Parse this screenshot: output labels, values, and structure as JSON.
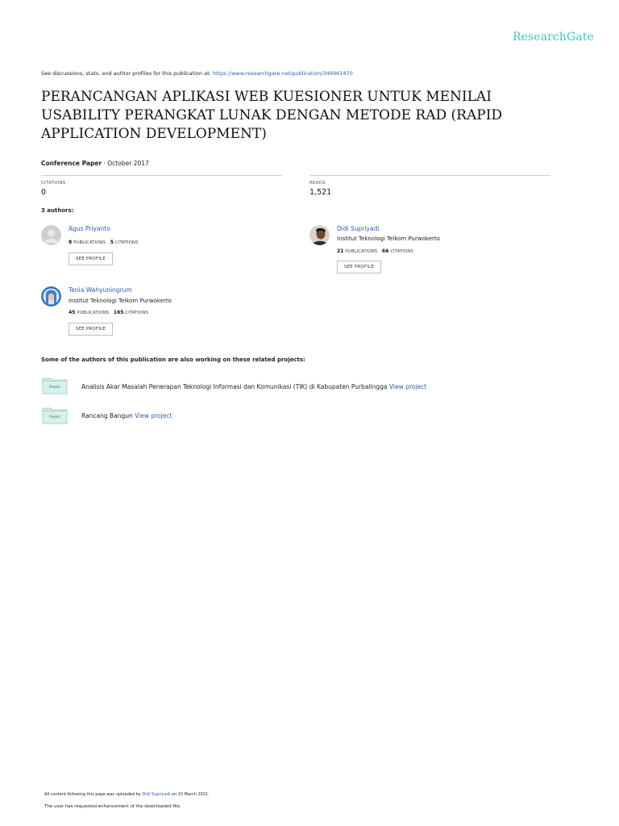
{
  "brand": {
    "logo_text": "ResearchGate",
    "accent_color": "#40c4b0",
    "link_color": "#2a5db0"
  },
  "header": {
    "intro_text": "See discussions, stats, and author profiles for this publication at: ",
    "publication_url": "https://www.researchgate.net/publication/349961470"
  },
  "paper": {
    "title": "PERANCANGAN APLIKASI WEB KUESIONER UNTUK MENILAI USABILITY PERANGKAT LUNAK DENGAN METODE RAD (RAPID APPLICATION DEVELOPMENT)",
    "type": "Conference Paper",
    "date_sep": " · ",
    "date": "October 2017"
  },
  "stats": {
    "citations_label": "CITATIONS",
    "citations_value": "0",
    "reads_label": "READS",
    "reads_value": "1,521"
  },
  "authors_heading": "3 authors:",
  "authors": [
    {
      "name": "Agus Priyanto",
      "institution": "",
      "publications": "8",
      "publications_label": "PUBLICATIONS",
      "citations": "5",
      "citations_label": "CITATIONS",
      "button": "SEE PROFILE"
    },
    {
      "name": "Didi Supriyadi",
      "institution": "Institut Teknologi Telkom Purwokerto",
      "publications": "21",
      "publications_label": "PUBLICATIONS",
      "citations": "66",
      "citations_label": "CITATIONS",
      "button": "SEE PROFILE"
    },
    {
      "name": "Tenia Wahyuningrum",
      "institution": "Institut Teknologi Telkom Purwokerto",
      "publications": "45",
      "publications_label": "PUBLICATIONS",
      "citations": "165",
      "citations_label": "CITATIONS",
      "button": "SEE PROFILE"
    }
  ],
  "related": {
    "heading": "Some of the authors of this publication are also working on these related projects:",
    "folder_label": "Project",
    "projects": [
      {
        "title": "Analisis Akar Masalah Penerapan Teknologi Informasi dan Komunikasi (TIK) di Kabupaten Purbalingga ",
        "link": "View project"
      },
      {
        "title": "Rancang Bangun ",
        "link": "View project"
      }
    ]
  },
  "footer": {
    "uploaded_prefix": "All content following this page was uploaded by ",
    "uploader": "Didi Supriyadi",
    "uploaded_suffix": " on 10 March 2021.",
    "note": "The user has requested enhancement of the downloaded file."
  }
}
